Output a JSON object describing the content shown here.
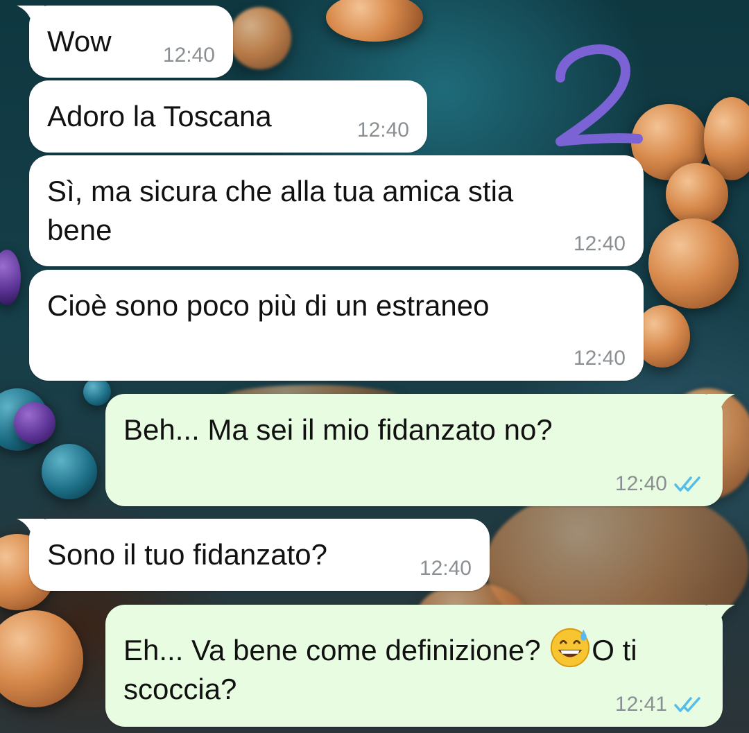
{
  "annotation": "2",
  "messages": [
    {
      "direction": "incoming",
      "text": "Wow",
      "time": "12:40"
    },
    {
      "direction": "incoming",
      "text": "Adoro la Toscana",
      "time": "12:40"
    },
    {
      "direction": "incoming",
      "text": "Sì, ma sicura che alla tua amica stia bene",
      "time": "12:40"
    },
    {
      "direction": "incoming",
      "text": "Cioè sono poco più di un estraneo",
      "time": "12:40"
    },
    {
      "direction": "outgoing",
      "text": "Beh... Ma sei il mio fidanzato no?",
      "time": "12:40",
      "status": "read"
    },
    {
      "direction": "incoming",
      "text": "Sono il tuo fidanzato?",
      "time": "12:40"
    },
    {
      "direction": "outgoing",
      "text_before_emoji": "Eh... Va bene come definizione? ",
      "emoji": "grinning-face-with-sweat",
      "text_after_emoji": "O ti scoccia?",
      "time": "12:41",
      "status": "read"
    }
  ],
  "colors": {
    "incoming_bubble": "#ffffff",
    "outgoing_bubble": "#e7fce0",
    "read_check": "#53bdeb",
    "annotation_ink": "#7b63d6"
  }
}
